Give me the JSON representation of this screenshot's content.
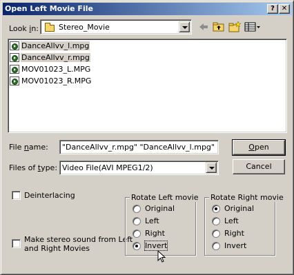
{
  "window": {
    "title": "Open Left Movie File",
    "help_button": "?",
    "close_button": "✕"
  },
  "look_in": {
    "label_pre": "Look ",
    "label_accel": "i",
    "label_post": "n:",
    "value": "Stereo_Movie"
  },
  "toolbar": {
    "back_icon": "back-arrow-icon",
    "up_icon": "up-folder-icon",
    "new_folder_icon": "new-folder-icon",
    "view_icon": "view-menu-icon"
  },
  "files": [
    {
      "name": "DanceAllvv_l.mpg",
      "selected": true
    },
    {
      "name": "DanceAllvv_r.mpg",
      "selected": true
    },
    {
      "name": "MOV01023_L.MPG",
      "selected": false
    },
    {
      "name": "MOV01023_R.MPG",
      "selected": false
    }
  ],
  "file_name": {
    "label_pre": "File ",
    "label_accel": "n",
    "label_post": "ame:",
    "value": "\"DanceAllvv_r.mpg\" \"DanceAllvv_l.mpg\""
  },
  "file_type": {
    "label_pre": "Files of ",
    "label_accel": "t",
    "label_post": "ype:",
    "value": "Video File(AVI MPEG1/2)"
  },
  "buttons": {
    "open_accel": "O",
    "open_rest": "pen",
    "cancel": "Cancel"
  },
  "options": {
    "deinterlacing": {
      "label": "Deinterlacing",
      "checked": false
    },
    "stereo_sound": {
      "label_line1": "Make stereo sound from Left",
      "label_line2": "and Right Movies",
      "checked": false
    }
  },
  "rotate_left": {
    "title": "Rotate Left movie",
    "options": [
      {
        "label": "Original",
        "checked": false
      },
      {
        "label": "Left",
        "checked": false
      },
      {
        "label": "Right",
        "checked": false
      },
      {
        "label": "Invert",
        "checked": true
      }
    ]
  },
  "rotate_right": {
    "title": "Rotate Right movie",
    "options": [
      {
        "label": "Original",
        "checked": true
      },
      {
        "label": "Left",
        "checked": false
      },
      {
        "label": "Right",
        "checked": false
      },
      {
        "label": "Invert",
        "checked": false
      }
    ]
  },
  "colors": {
    "title_start": "#0a246a",
    "title_end": "#a6caf0",
    "face": "#d4d0c8"
  }
}
